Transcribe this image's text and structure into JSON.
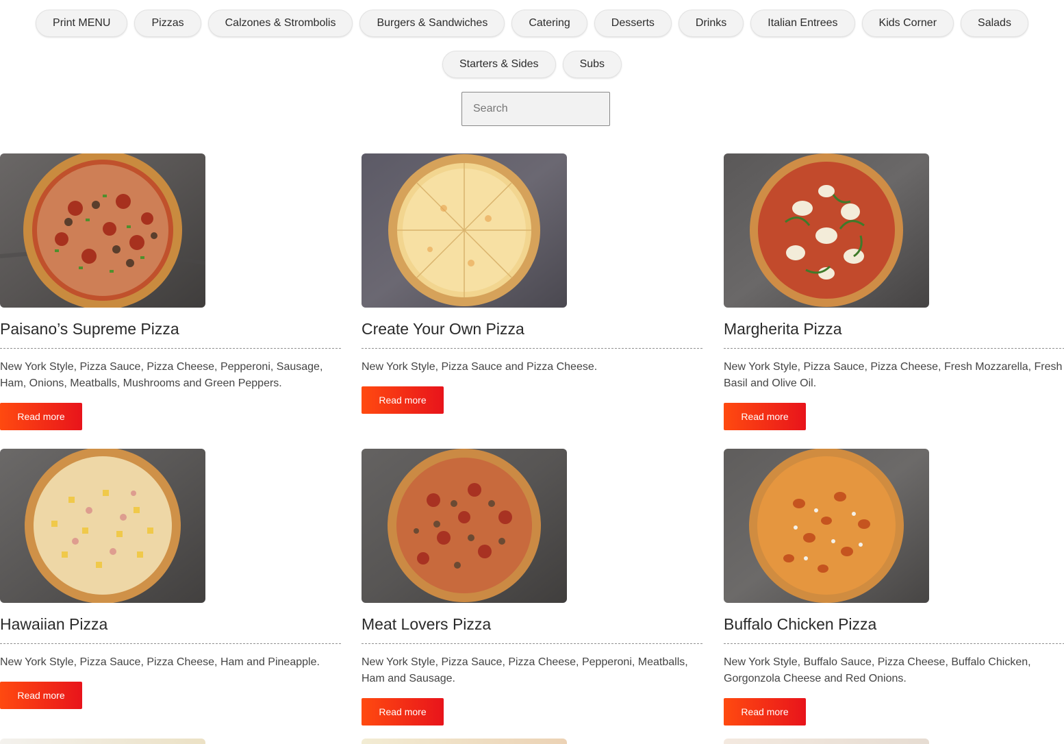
{
  "categories_row1": [
    "Print MENU",
    "Pizzas",
    "Calzones & Strombolis",
    "Burgers & Sandwiches",
    "Catering",
    "Desserts",
    "Drinks",
    "Italian Entrees",
    "Kids Corner",
    "Salads"
  ],
  "categories_row2": [
    "Starters & Sides",
    "Subs"
  ],
  "search": {
    "placeholder": "Search"
  },
  "read_more_label": "Read more",
  "items": [
    {
      "title": "Paisano’s Supreme Pizza",
      "desc": "New York Style, Pizza Sauce, Pizza Cheese, Pepperoni, Sausage, Ham, Onions, Meatballs, Mushrooms and Green Peppers."
    },
    {
      "title": "Create Your Own Pizza",
      "desc": "New York Style, Pizza Sauce and Pizza Cheese."
    },
    {
      "title": "Margherita Pizza",
      "desc": "New York Style, Pizza Sauce, Pizza Cheese, Fresh Mozzarella, Fresh Basil and Olive Oil."
    },
    {
      "title": "Hawaiian Pizza",
      "desc": "New York Style, Pizza Sauce, Pizza Cheese, Ham and Pineapple."
    },
    {
      "title": "Meat Lovers Pizza",
      "desc": "New York Style, Pizza Sauce, Pizza Cheese, Pepperoni, Meatballs, Ham and Sausage."
    },
    {
      "title": "Buffalo Chicken Pizza",
      "desc": "New York Style, Buffalo Sauce, Pizza Cheese, Buffalo Chicken, Gorgonzola Cheese and Red Onions."
    }
  ],
  "colors": {
    "button_start": "#ff4a10",
    "button_end": "#e8141b",
    "pill_bg": "#f3f3f3"
  }
}
